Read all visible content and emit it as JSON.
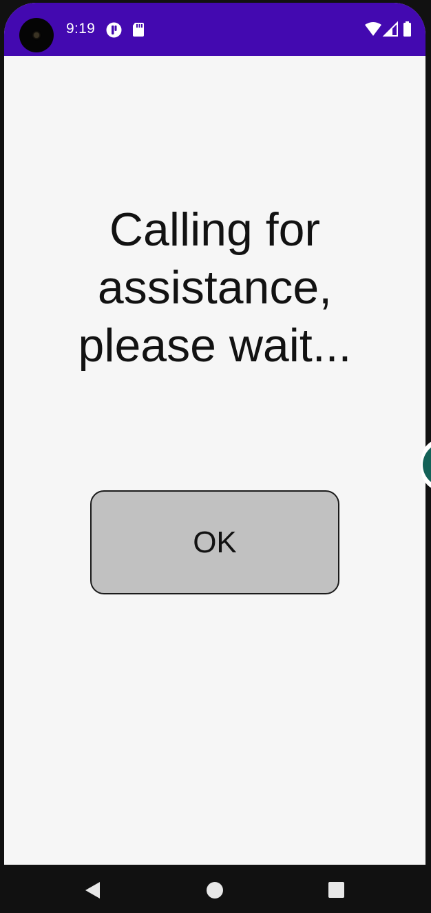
{
  "status_bar": {
    "time": "9:19",
    "background": "#4309b0",
    "left_icons": [
      "notification-app-icon",
      "sd-card-icon"
    ],
    "right_icons": [
      "wifi-icon",
      "cellular-signal-icon",
      "battery-icon"
    ]
  },
  "main": {
    "message": "Calling for assistance, please wait...",
    "ok_button_label": "OK",
    "ok_button_color": "#c1c1c1"
  },
  "nav_bar": {
    "buttons": [
      "back-icon",
      "home-icon",
      "recents-icon"
    ]
  }
}
